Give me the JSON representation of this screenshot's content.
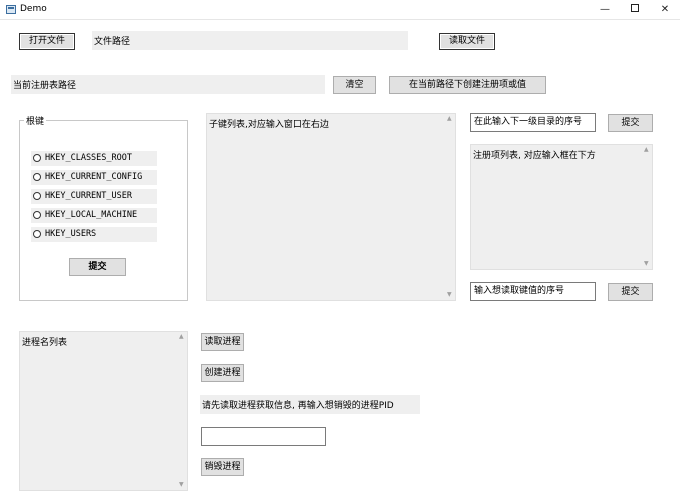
{
  "window": {
    "title": "Demo",
    "min_symbol": "—",
    "close_symbol": "✕"
  },
  "file": {
    "open_button": "打开文件",
    "path_label": "文件路径",
    "read_button": "读取文件"
  },
  "registry": {
    "current_path_label": "当前注册表路径",
    "clear_button": "清空",
    "create_button": "在当前路径下创建注册项或值",
    "root_group_title": "根键",
    "root_keys": [
      "HKEY_CLASSES_ROOT",
      "HKEY_CURRENT_CONFIG",
      "HKEY_CURRENT_USER",
      "HKEY_LOCAL_MACHINE",
      "HKEY_USERS"
    ],
    "root_submit_button": "提交",
    "subkey_list_text": "子键列表,对应输入窗口在右边",
    "subdir_index_input": "在此输入下一级目录的序号",
    "subdir_submit_button": "提交",
    "value_list_text": "注册项列表, 对应输入框在下方",
    "value_index_input": "输入想读取键值的序号",
    "value_submit_button": "提交"
  },
  "process": {
    "list_text": "进程名列表",
    "read_button": "读取进程",
    "create_button": "创建进程",
    "hint_text": "请先读取进程获取信息, 再输入想销毁的进程PID",
    "pid_input": "",
    "kill_button": "销毁进程"
  },
  "icons": {
    "scroll_up": "▲",
    "scroll_down": "▼"
  }
}
